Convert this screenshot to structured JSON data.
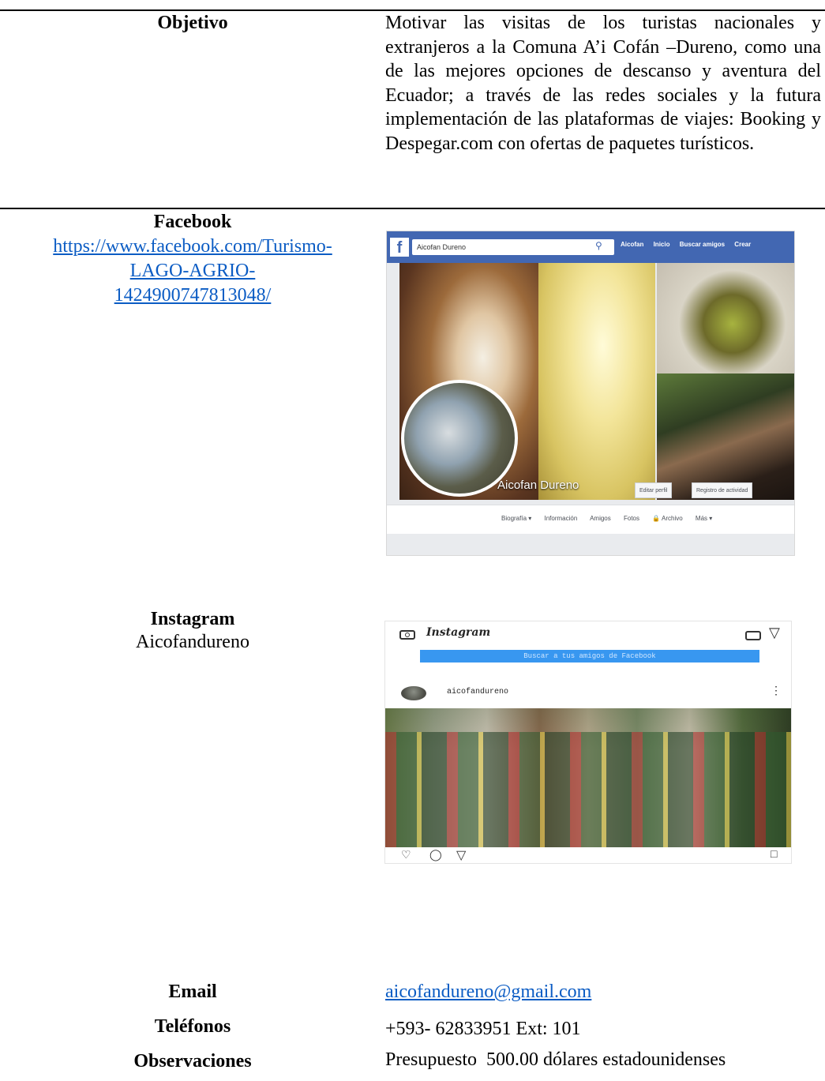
{
  "objetivo": {
    "label": "Objetivo",
    "text": "Motivar las visitas de los turistas nacionales y extranjeros a la Comuna A’i Cofán –Dureno, como una de las mejores opciones de descanso y aventura del Ecuador; a través de las redes sociales y la futura implementación de las plataformas de viajes: Booking y Despegar.com con ofertas de paquetes turísticos."
  },
  "facebook": {
    "label": "Facebook",
    "link_line1": "https://www.facebook.com/Turismo-",
    "link_line2": "LAGO-AGRIO-",
    "link_line3": "1424900747813048/",
    "screenshot": {
      "logo": "f",
      "search_text": "Aicofan Dureno",
      "nav_items": [
        "Aicofan",
        "Inicio",
        "Buscar amigos",
        "Crear"
      ],
      "profile_name": "Aicofan Dureno",
      "edit_profile_btn": "Editar perfil",
      "activity_log_btn": "Registro de actividad",
      "tabs": [
        "Biografía ▾",
        "Información",
        "Amigos",
        "Fotos",
        "🔒 Archivo",
        "Más ▾"
      ]
    }
  },
  "instagram": {
    "label": "Instagram",
    "account": "Aicofandureno",
    "screenshot": {
      "wordmark": "Instagram",
      "banner_text": "Buscar a tus amigos de Facebook",
      "username": "aicofandureno"
    }
  },
  "contact": {
    "email_label": "Email",
    "email_value": "aicofandureno@gmail.com",
    "phones_label": "Teléfonos",
    "phones_value": "+593- 62833951 Ext: 101",
    "notes_label": "Observaciones",
    "notes_value": "Presupuesto  500.00 dólares estadounidenses"
  }
}
